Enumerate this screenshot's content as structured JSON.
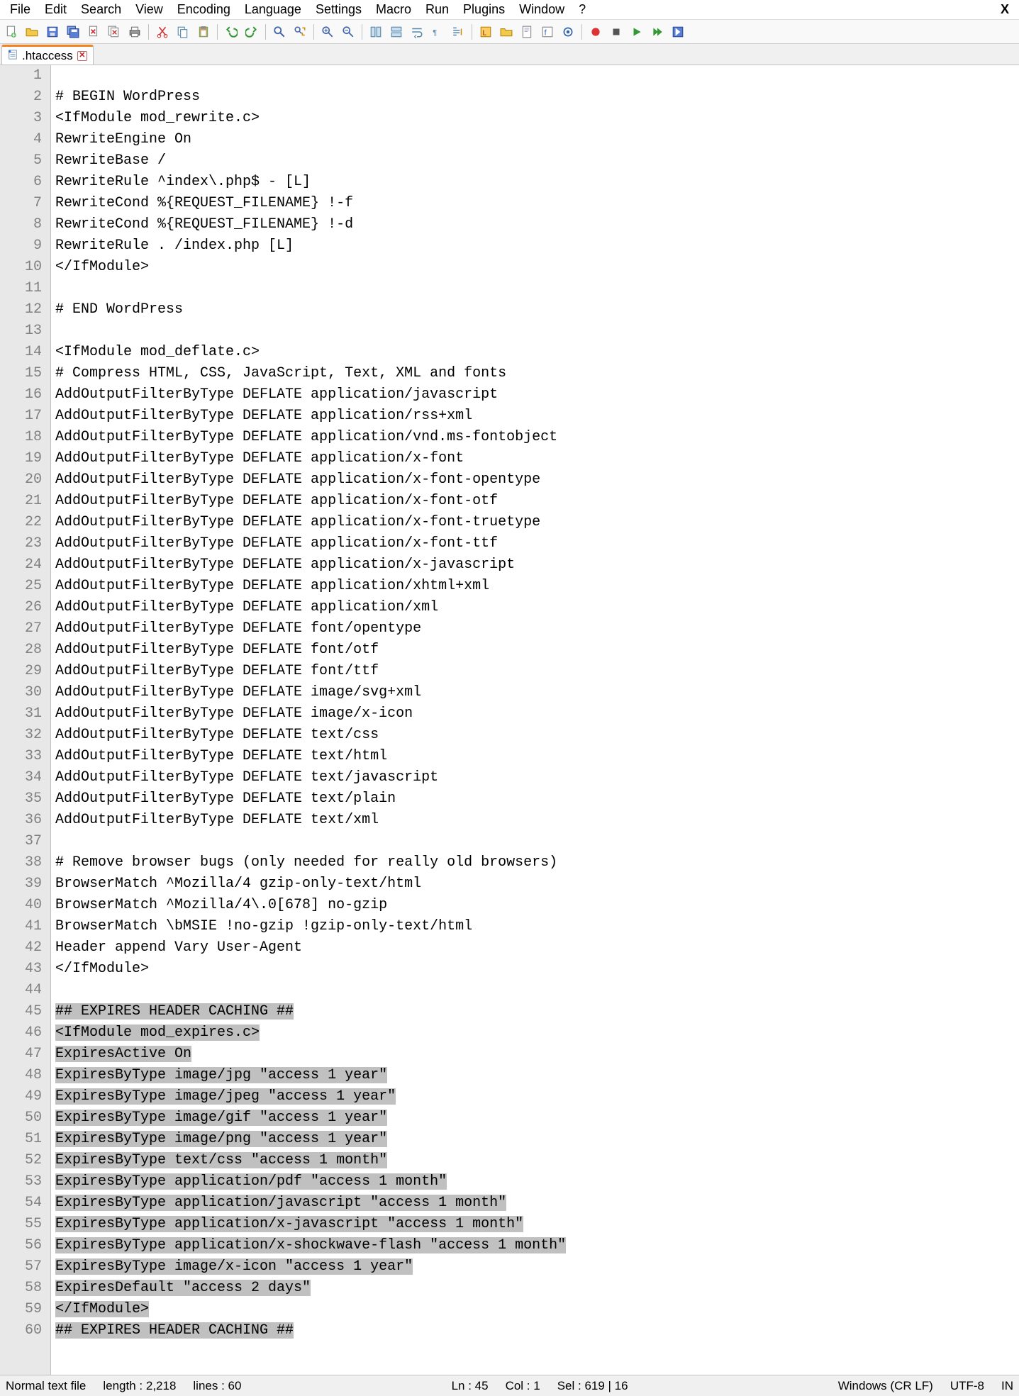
{
  "menu": {
    "items": [
      "File",
      "Edit",
      "Search",
      "View",
      "Encoding",
      "Language",
      "Settings",
      "Macro",
      "Run",
      "Plugins",
      "Window",
      "?"
    ],
    "close": "X"
  },
  "toolbar_icons": [
    "new-file-icon",
    "open-file-icon",
    "save-icon",
    "save-all-icon",
    "close-file-icon",
    "close-all-icon",
    "print-icon",
    "sep",
    "cut-icon",
    "copy-icon",
    "paste-icon",
    "sep",
    "undo-icon",
    "redo-icon",
    "sep",
    "find-icon",
    "replace-icon",
    "sep",
    "zoom-in-icon",
    "zoom-out-icon",
    "sep",
    "sync-vert-icon",
    "sync-horiz-icon",
    "wrap-icon",
    "show-chars-icon",
    "indent-guide-icon",
    "sep",
    "udl-icon",
    "folder-icon",
    "doc-map-icon",
    "func-list-icon",
    "monitor-icon",
    "sep",
    "record-icon",
    "stop-icon",
    "play-icon",
    "play-multi-icon",
    "save-macro-icon"
  ],
  "tab": {
    "label": ".htaccess"
  },
  "code_lines": [
    "",
    "# BEGIN WordPress",
    "<IfModule mod_rewrite.c>",
    "RewriteEngine On",
    "RewriteBase /",
    "RewriteRule ^index\\.php$ - [L]",
    "RewriteCond %{REQUEST_FILENAME} !-f",
    "RewriteCond %{REQUEST_FILENAME} !-d",
    "RewriteRule . /index.php [L]",
    "</IfModule>",
    "",
    "# END WordPress",
    "",
    "<IfModule mod_deflate.c>",
    "# Compress HTML, CSS, JavaScript, Text, XML and fonts",
    "AddOutputFilterByType DEFLATE application/javascript",
    "AddOutputFilterByType DEFLATE application/rss+xml",
    "AddOutputFilterByType DEFLATE application/vnd.ms-fontobject",
    "AddOutputFilterByType DEFLATE application/x-font",
    "AddOutputFilterByType DEFLATE application/x-font-opentype",
    "AddOutputFilterByType DEFLATE application/x-font-otf",
    "AddOutputFilterByType DEFLATE application/x-font-truetype",
    "AddOutputFilterByType DEFLATE application/x-font-ttf",
    "AddOutputFilterByType DEFLATE application/x-javascript",
    "AddOutputFilterByType DEFLATE application/xhtml+xml",
    "AddOutputFilterByType DEFLATE application/xml",
    "AddOutputFilterByType DEFLATE font/opentype",
    "AddOutputFilterByType DEFLATE font/otf",
    "AddOutputFilterByType DEFLATE font/ttf",
    "AddOutputFilterByType DEFLATE image/svg+xml",
    "AddOutputFilterByType DEFLATE image/x-icon",
    "AddOutputFilterByType DEFLATE text/css",
    "AddOutputFilterByType DEFLATE text/html",
    "AddOutputFilterByType DEFLATE text/javascript",
    "AddOutputFilterByType DEFLATE text/plain",
    "AddOutputFilterByType DEFLATE text/xml",
    "",
    "# Remove browser bugs (only needed for really old browsers)",
    "BrowserMatch ^Mozilla/4 gzip-only-text/html",
    "BrowserMatch ^Mozilla/4\\.0[678] no-gzip",
    "BrowserMatch \\bMSIE !no-gzip !gzip-only-text/html",
    "Header append Vary User-Agent",
    "</IfModule>",
    "",
    "## EXPIRES HEADER CACHING ##",
    "<IfModule mod_expires.c>",
    "ExpiresActive On",
    "ExpiresByType image/jpg \"access 1 year\"",
    "ExpiresByType image/jpeg \"access 1 year\"",
    "ExpiresByType image/gif \"access 1 year\"",
    "ExpiresByType image/png \"access 1 year\"",
    "ExpiresByType text/css \"access 1 month\"",
    "ExpiresByType application/pdf \"access 1 month\"",
    "ExpiresByType application/javascript \"access 1 month\"",
    "ExpiresByType application/x-javascript \"access 1 month\"",
    "ExpiresByType application/x-shockwave-flash \"access 1 month\"",
    "ExpiresByType image/x-icon \"access 1 year\"",
    "ExpiresDefault \"access 2 days\"",
    "</IfModule>",
    "## EXPIRES HEADER CACHING ##"
  ],
  "current_line_index": 44,
  "selection_start_index": 44,
  "status": {
    "filetype": "Normal text file",
    "length_label": "length : 2,218",
    "lines_label": "lines : 60",
    "ln": "Ln : 45",
    "col": "Col : 1",
    "sel": "Sel : 619 | 16",
    "eol": "Windows (CR LF)",
    "encoding": "UTF-8",
    "ovr": "IN"
  }
}
